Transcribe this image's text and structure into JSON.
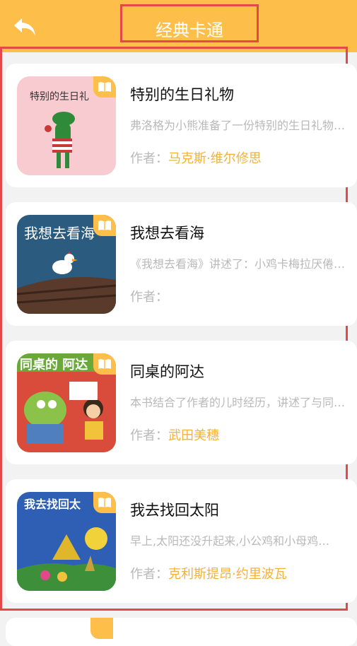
{
  "header": {
    "title": "经典卡通"
  },
  "colors": {
    "accent": "#fdbf4a",
    "author": "#f2b23c",
    "highlight": "#e54848"
  },
  "author_label": "作者：",
  "books": [
    {
      "title": "特别的生日礼物",
      "desc": "弗洛格为小熊准备了一份特别的生日礼物…",
      "author_name": "马克斯·维尔修思",
      "cover_text": "特别的生日礼"
    },
    {
      "title": "我想去看海",
      "desc": "《我想去看海》讲述了：小鸡卡梅拉厌倦了…",
      "author_name": "",
      "cover_text": "我想去看海"
    },
    {
      "title": "同桌的阿达",
      "desc": "本书结合了作者的儿时经历，讲述了与同桌…",
      "author_name": "武田美穗",
      "cover_text": "同桌的 阿达"
    },
    {
      "title": "我去找回太阳",
      "desc": "早上,太阳还没升起来,小公鸡和小母鸡…",
      "author_name": "克利斯提昂·约里波瓦",
      "cover_text": "我去找回太"
    }
  ]
}
